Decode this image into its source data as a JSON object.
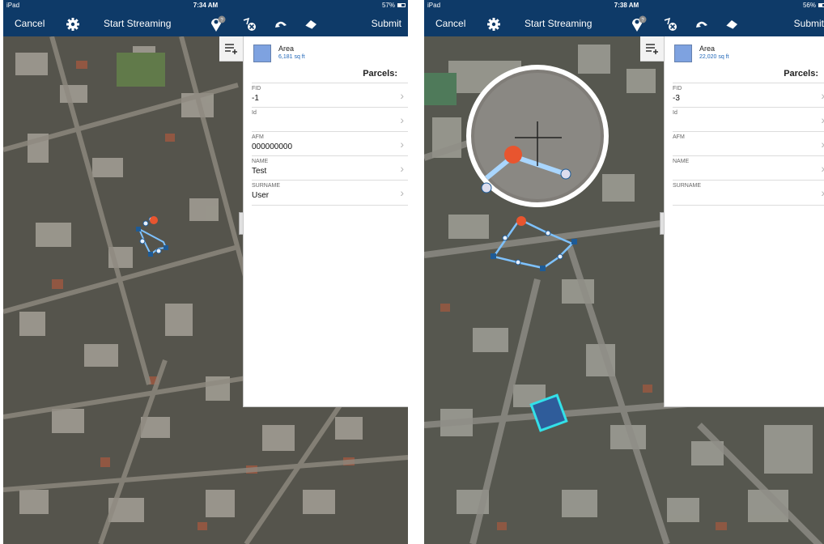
{
  "left": {
    "status": {
      "device": "iPad",
      "time": "7:34 AM",
      "battery": "57%"
    },
    "nav": {
      "cancel": "Cancel",
      "start_streaming": "Start Streaming",
      "submit": "Submit",
      "badge": "?"
    },
    "area": {
      "label": "Area",
      "value": "6,181 sq ft"
    },
    "parcels_title": "Parcels:",
    "fields": [
      {
        "label": "FID",
        "value": "-1"
      },
      {
        "label": "Id",
        "value": ""
      },
      {
        "label": "AFM",
        "value": "000000000"
      },
      {
        "label": "NAME",
        "value": "Test"
      },
      {
        "label": "SURNAME",
        "value": "User"
      }
    ]
  },
  "right": {
    "status": {
      "device": "iPad",
      "time": "7:38 AM",
      "battery": "56%"
    },
    "nav": {
      "cancel": "Cancel",
      "start_streaming": "Start Streaming",
      "submit": "Submit",
      "badge": "?"
    },
    "area": {
      "label": "Area",
      "value": "22,020 sq ft"
    },
    "parcels_title": "Parcels:",
    "fields": [
      {
        "label": "FID",
        "value": "-3"
      },
      {
        "label": "Id",
        "value": ""
      },
      {
        "label": "AFM",
        "value": ""
      },
      {
        "label": "NAME",
        "value": ""
      },
      {
        "label": "SURNAME",
        "value": ""
      }
    ]
  },
  "colors": {
    "nav_bg": "#0e3a68",
    "sketch_line": "#5aa6ff",
    "vertex_active": "#e8552f",
    "vertex_node": "#1e5b96",
    "area_swatch": "#7ea2e0",
    "selected_parcel": "#33e0e8"
  },
  "icons": [
    "gear-icon",
    "streaming-location-icon",
    "clear-sketch-icon",
    "undo-icon",
    "eraser-icon",
    "add-feature-icon",
    "chevron-right-icon",
    "magnifier-crosshair-icon"
  ]
}
